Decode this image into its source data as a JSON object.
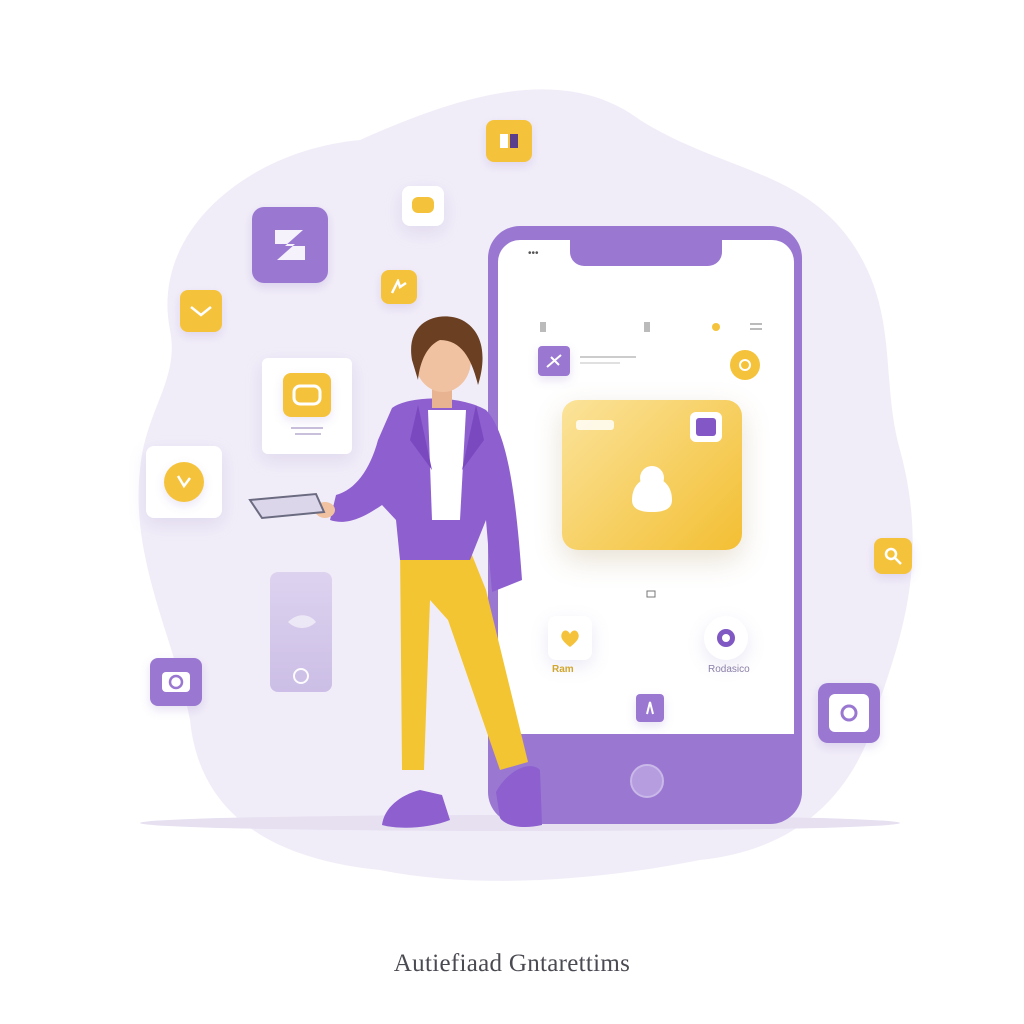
{
  "caption": "Autiefiaad Gntarettims",
  "phone": {
    "status_left": "•••",
    "app_label_left": "Ram",
    "app_label_right": "Rodasico"
  },
  "icons": [
    "grid-icon",
    "chat-icon",
    "note-icon",
    "sparkle-icon",
    "mail-icon",
    "photo-icon",
    "clock-icon",
    "camera-icon",
    "image-icon",
    "search-icon",
    "user-icon",
    "heart-icon",
    "settings-icon",
    "wallet-icon"
  ],
  "colors": {
    "purple": "#9a78d2",
    "purple_dark": "#7f58c4",
    "yellow": "#f5c33b",
    "lavender_blob": "#efeaf7"
  }
}
